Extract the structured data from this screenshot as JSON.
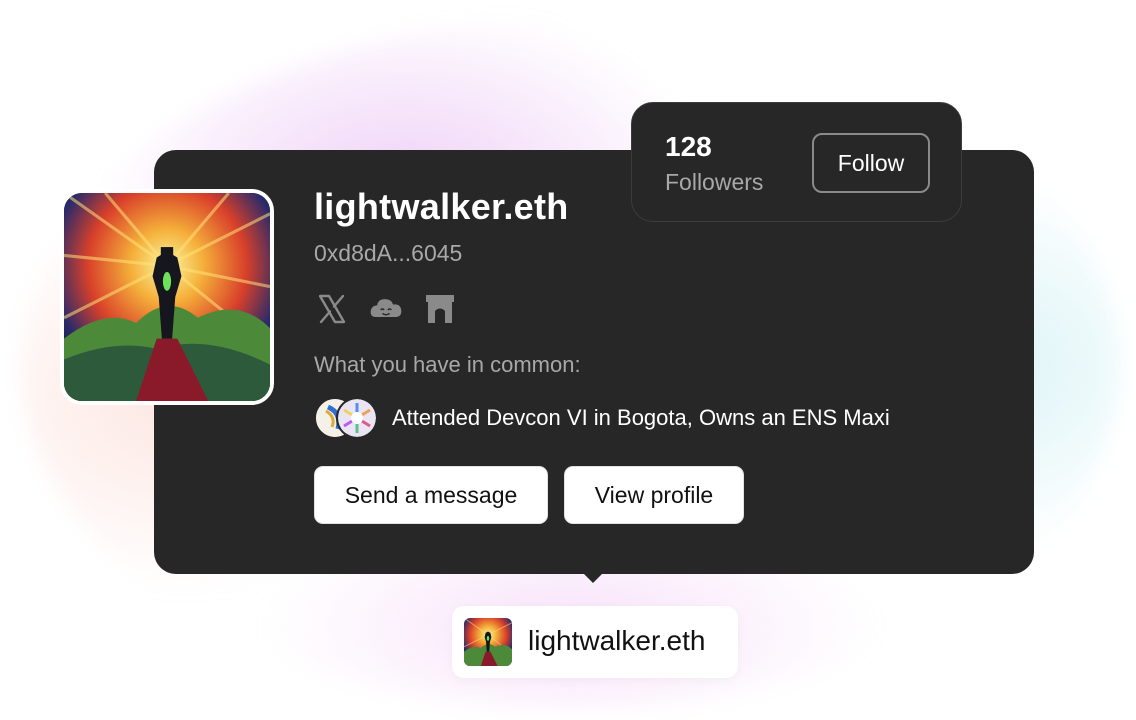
{
  "profile": {
    "name": "lightwalker.eth",
    "address": "0xd8dA...6045",
    "socials": [
      {
        "icon": "x-twitter-icon"
      },
      {
        "icon": "cloud-face-icon"
      },
      {
        "icon": "gateway-arch-icon"
      }
    ],
    "common_label": "What you have in common:",
    "common_text": "Attended Devcon VI in Bogota, Owns an ENS Maxi"
  },
  "actions": {
    "message_label": "Send a message",
    "profile_label": "View profile"
  },
  "followers": {
    "count": "128",
    "label": "Followers",
    "follow_label": "Follow"
  },
  "chip": {
    "name": "lightwalker.eth"
  },
  "colors": {
    "card_bg": "#272727",
    "muted_text": "#a8a8a8",
    "button_bg": "#ffffff"
  }
}
